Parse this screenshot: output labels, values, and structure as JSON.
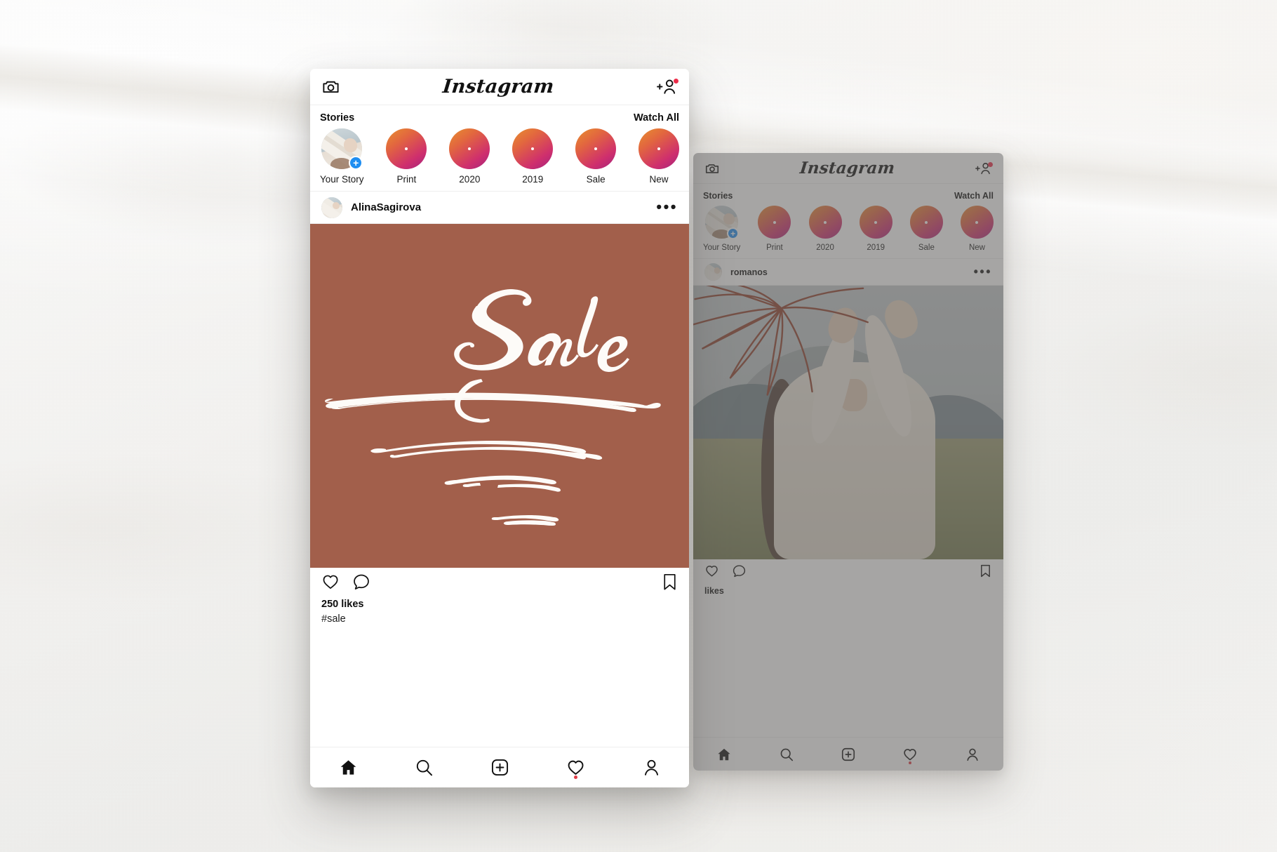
{
  "background": {
    "surface": "paper-texture-white",
    "color": "#f2f1ef"
  },
  "colors": {
    "terracotta": "#a25f4b",
    "story_print": "#a2604a",
    "story_2020": "#3b4c42",
    "story_2019": "#b0b29c",
    "story_sale": "#ece7e0",
    "story_new": "#d3c6b5",
    "ring_gradient_start": "#e8902f",
    "ring_gradient_end": "#a3257e",
    "notification_red": "#ed2d4a",
    "plus_badge_blue": "#1f8ef1",
    "accent_heart_dot": "#e03b46"
  },
  "front_phone": {
    "header": {
      "camera_icon": "camera-icon",
      "logo": "Instagram",
      "add_person_icon": "add-person-icon",
      "has_notification_dot": true
    },
    "stories": {
      "title": "Stories",
      "watch_all": "Watch All",
      "items": [
        {
          "label": "Your Story",
          "type": "photo",
          "has_plus_badge": true
        },
        {
          "label": "Print",
          "type": "swatch",
          "color": "#a2604a"
        },
        {
          "label": "2020",
          "type": "swatch",
          "color": "#3b4c42"
        },
        {
          "label": "2019",
          "type": "swatch",
          "color": "#b0b29c"
        },
        {
          "label": "Sale",
          "type": "swatch",
          "color": "#ece7e0"
        },
        {
          "label": "New",
          "type": "swatch",
          "color": "#d3c6b5"
        }
      ]
    },
    "post": {
      "username": "AlinaSagirova",
      "more_icon": "more-options-icon",
      "media": {
        "type": "graphic",
        "background_color": "#a25f4b",
        "headline": "Sale",
        "style": "handwritten-brush-script-white"
      },
      "actions": {
        "like_icon": "heart-icon",
        "comment_icon": "comment-icon",
        "save_icon": "bookmark-icon"
      },
      "likes": "250 likes",
      "caption": "#sale"
    },
    "bottom_nav": [
      {
        "icon": "home-icon",
        "active": true,
        "badge": false
      },
      {
        "icon": "search-icon",
        "active": false,
        "badge": false
      },
      {
        "icon": "add-post-icon",
        "active": false,
        "badge": false
      },
      {
        "icon": "heart-icon",
        "active": false,
        "badge": true
      },
      {
        "icon": "profile-icon",
        "active": false,
        "badge": false
      }
    ]
  },
  "back_phone": {
    "header": {
      "camera_icon": "camera-icon",
      "logo": "Instagram",
      "add_person_icon": "add-person-icon",
      "has_notification_dot": true
    },
    "stories": {
      "title": "Stories",
      "watch_all": "Watch All",
      "items": [
        {
          "label": "Your Story",
          "type": "photo",
          "has_plus_badge": true
        },
        {
          "label": "Print",
          "type": "swatch",
          "color": "#a2604a"
        },
        {
          "label": "2020",
          "type": "swatch",
          "color": "#3b4c42"
        },
        {
          "label": "2019",
          "type": "swatch",
          "color": "#b0b29c"
        },
        {
          "label": "Sale",
          "type": "swatch",
          "color": "#ece7e0"
        },
        {
          "label": "New",
          "type": "swatch",
          "color": "#d3c6b5"
        }
      ]
    },
    "post": {
      "username": "romanos",
      "more_icon": "more-options-icon",
      "media": {
        "type": "photo",
        "description": "woman in white knit sweater in a field with hills, terracotta botanical line-art overlay"
      },
      "actions": {
        "like_icon": "heart-icon",
        "comment_icon": "comment-icon",
        "save_icon": "bookmark-icon"
      },
      "likes": "likes",
      "caption": ""
    },
    "bottom_nav": [
      {
        "icon": "home-icon",
        "active": true,
        "badge": false
      },
      {
        "icon": "search-icon",
        "active": false,
        "badge": false
      },
      {
        "icon": "add-post-icon",
        "active": false,
        "badge": false
      },
      {
        "icon": "heart-icon",
        "active": false,
        "badge": true
      },
      {
        "icon": "profile-icon",
        "active": false,
        "badge": false
      }
    ]
  }
}
